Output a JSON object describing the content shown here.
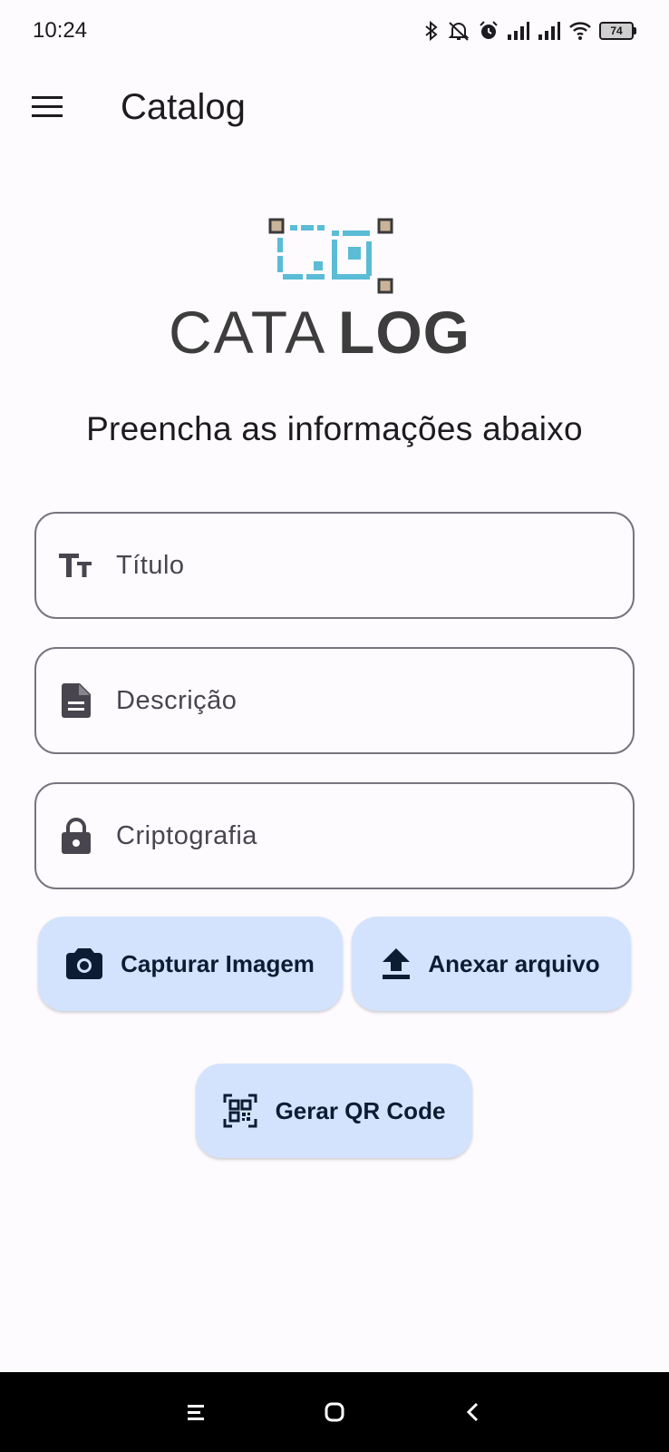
{
  "status_bar": {
    "time": "10:24",
    "battery": "74",
    "icons": [
      "bluetooth-icon",
      "alarm-off-icon",
      "alarm-icon",
      "signal-icon",
      "signal-icon",
      "wifi-icon",
      "battery-icon"
    ]
  },
  "app_bar": {
    "title": "Catalog",
    "menu_icon": "menu-icon"
  },
  "logo": {
    "text_light": "CATA",
    "text_bold": "LOG",
    "monogram": "CG",
    "colors": {
      "accent": "#5bbcd6",
      "corner": "#c9b49a",
      "corner_border": "#3a3a3a",
      "text": "#3d3d3d"
    }
  },
  "form": {
    "heading": "Preencha as informações abaixo",
    "fields": [
      {
        "placeholder": "Título",
        "value": "",
        "icon": "text-fields-icon"
      },
      {
        "placeholder": "Descrição",
        "value": "",
        "icon": "document-icon"
      },
      {
        "placeholder": "Criptografia",
        "value": "",
        "icon": "lock-icon"
      }
    ],
    "buttons": {
      "capture": {
        "label": "Capturar Imagem",
        "icon": "camera-icon"
      },
      "attach": {
        "label": "Anexar arquivo",
        "icon": "upload-icon"
      },
      "qr": {
        "label": "Gerar QR Code",
        "icon": "qr-code-icon"
      }
    }
  },
  "colors": {
    "background": "#fefbff",
    "button_bg": "#d3e3fd",
    "outline": "#79747e",
    "nav_bar": "#000000"
  }
}
